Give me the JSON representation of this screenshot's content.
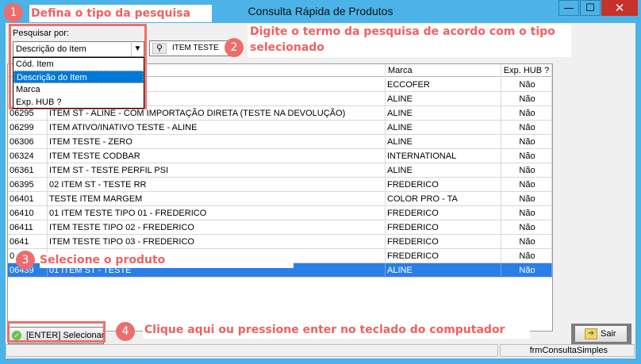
{
  "window": {
    "title": "Consulta Rápida de Produtos",
    "min_glyph": "—",
    "max_glyph": "☐",
    "close_glyph": "✕"
  },
  "search": {
    "group_label": "Pesquisar por:",
    "selected_option": "Descrição do Item",
    "options": [
      "Cód. Item",
      "Descrição do Item",
      "Marca",
      "Exp. HUB ?"
    ],
    "term_value": "ITEM TESTE"
  },
  "table": {
    "columns": [
      "",
      "",
      "Marca",
      "Exp. HUB ?"
    ],
    "rows": [
      {
        "code": "",
        "desc": "",
        "brand": "ECCOFER",
        "hub": "Não"
      },
      {
        "code": "",
        "desc": "RA COMPRA",
        "brand": "ALINE",
        "hub": "Não"
      },
      {
        "code": "06295",
        "desc": "ITEM ST - ALINE - COM IMPORTAÇÃO DIRETA (TESTE NA DEVOLUÇÃO)",
        "brand": "ALINE",
        "hub": "Não"
      },
      {
        "code": "06299",
        "desc": "ITEM ATIVO/INATIVO TESTE - ALINE",
        "brand": "ALINE",
        "hub": "Não"
      },
      {
        "code": "06306",
        "desc": "ITEM TESTE - ZERO",
        "brand": "ALINE",
        "hub": "Não"
      },
      {
        "code": "06324",
        "desc": "ITEM  TESTE CODBAR",
        "brand": "INTERNATIONAL",
        "hub": "Não"
      },
      {
        "code": "06361",
        "desc": "ITEM ST - TESTE PERFIL PSI",
        "brand": "ALINE",
        "hub": "Não"
      },
      {
        "code": "06395",
        "desc": "02 ITEM ST - TESTE RR",
        "brand": "FREDERICO",
        "hub": "Não"
      },
      {
        "code": "06401",
        "desc": "TESTE ITEM MARGEM",
        "brand": "COLOR PRO - TA",
        "hub": "Não"
      },
      {
        "code": "06410",
        "desc": "01 ITEM TESTE TIPO 01 - FREDERICO",
        "brand": "FREDERICO",
        "hub": "Não"
      },
      {
        "code": "06411",
        "desc": "ITEM TESTE TIPO 02 - FREDERICO",
        "brand": "FREDERICO",
        "hub": "Não"
      },
      {
        "code": "0641",
        "desc": "ITEM TESTE TIPO 03 - FREDERICO",
        "brand": "FREDERICO",
        "hub": "Não"
      },
      {
        "code": "0",
        "desc": "",
        "brand": "FREDERICO",
        "hub": "Não"
      },
      {
        "code": "06439",
        "desc": "01 ITEM ST - TESTE",
        "brand": "ALINE",
        "hub": "Não"
      }
    ]
  },
  "buttons": {
    "select_label": "[ENTER] Selecionar",
    "exit_label": "Sair",
    "ok_glyph": "✓",
    "exit_glyph": "➜"
  },
  "status": {
    "form_name": "frmConsultaSimples"
  },
  "annotations": [
    {
      "n": "1",
      "text": "Defina o tipo da pesquisa"
    },
    {
      "n": "2",
      "text": "Digite o termo da pesquisa de acordo com o tipo"
    },
    {
      "n": "3",
      "text": "Selecione o produto"
    },
    {
      "n": "4",
      "text": "Clique aqui ou pressione enter no teclado do computador"
    }
  ],
  "annotation_line2": "selecionado",
  "colors": {
    "titlebar": "#4bb3e8",
    "close": "#c7312b",
    "selected_row": "#2a7ee6",
    "annotation": "#ee6f6f"
  }
}
